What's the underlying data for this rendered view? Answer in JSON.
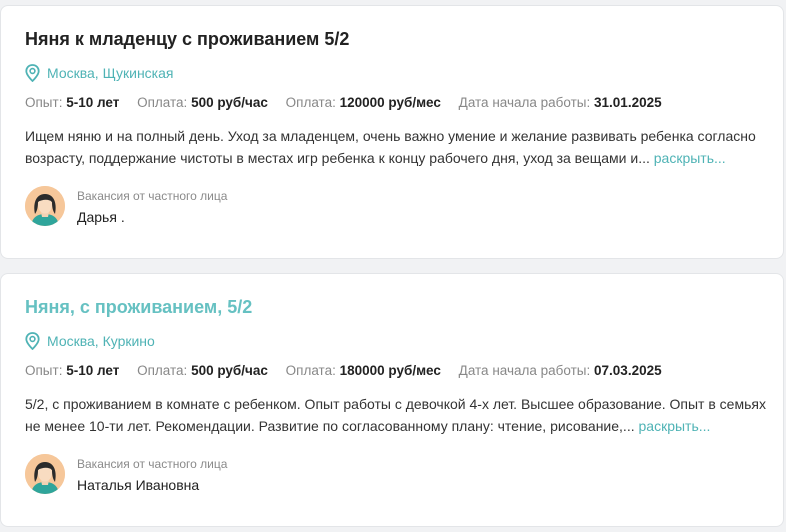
{
  "vacancies": [
    {
      "title": "Няня к младенцу с проживанием 5/2",
      "location": "Москва, Щукинская",
      "meta": [
        {
          "label": "Опыт:",
          "value": "5-10 лет"
        },
        {
          "label": "Оплата:",
          "value": "500 руб/час"
        },
        {
          "label": "Оплата:",
          "value": "120000 руб/мес"
        },
        {
          "label": "Дата начала работы:",
          "value": "31.01.2025"
        }
      ],
      "description": "Ищем няню и на полный день. Уход за младенцем, очень важно умение и желание развивать ребенка согласно возрасту, поддержание чистоты в местах игр ребенка к концу рабочего дня, уход за вещами и...",
      "more_label": "раскрыть...",
      "author_type": "Вакансия от частного лица",
      "author_name": "Дарья ."
    },
    {
      "title": "Няня, с проживанием, 5/2",
      "location": "Москва, Куркино",
      "meta": [
        {
          "label": "Опыт:",
          "value": "5-10 лет"
        },
        {
          "label": "Оплата:",
          "value": "500 руб/час"
        },
        {
          "label": "Оплата:",
          "value": "180000 руб/мес"
        },
        {
          "label": "Дата начала работы:",
          "value": "07.03.2025"
        }
      ],
      "description": "5/2, с проживанием в комнате с ребенком. Опыт работы с девочкой 4-х лет. Высшее образование. Опыт в семьях не менее 10-ти лет. Рекомендации. Развитие по согласованному плану: чтение, рисование,...",
      "more_label": "раскрыть...",
      "author_type": "Вакансия от частного лица",
      "author_name": "Наталья Ивановна"
    }
  ],
  "colors": {
    "accent": "#4fb3b5",
    "title_link": "#66c1c2"
  },
  "icons": {
    "location": "map-pin-icon",
    "avatar": "avatar-woman-icon"
  }
}
